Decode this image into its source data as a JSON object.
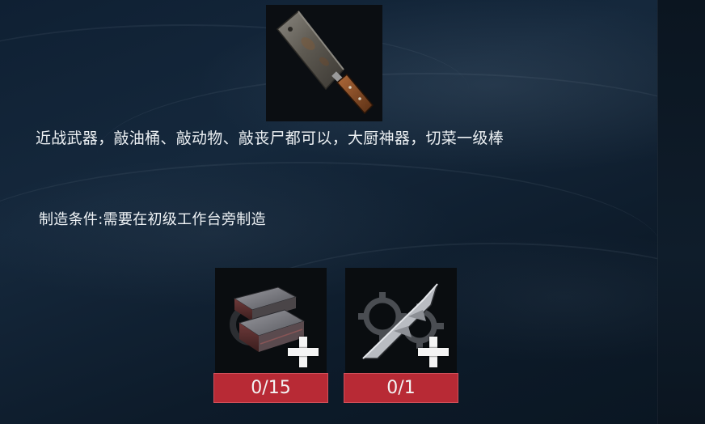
{
  "item": {
    "icon": "cleaver-icon",
    "description": "近战武器，敲油桶、敲动物、敲丧尸都可以，大厨神器，切菜一级棒",
    "condition": "制造条件:需要在初级工作台旁制造"
  },
  "materials": [
    {
      "icon": "metal-ingot-icon",
      "count": "0/15"
    },
    {
      "icon": "blade-part-icon",
      "count": "0/1"
    }
  ],
  "colors": {
    "count_bar": "#b82a35",
    "text": "#ecf0f3"
  }
}
